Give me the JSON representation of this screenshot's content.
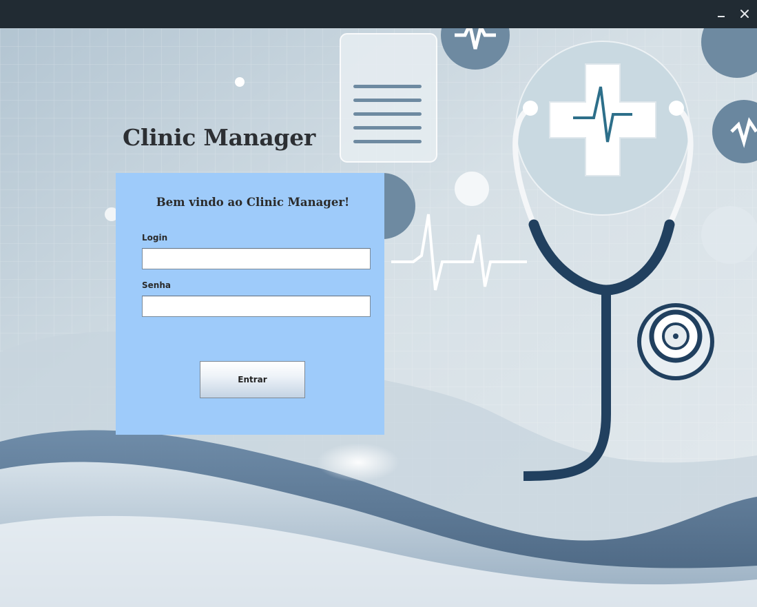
{
  "window": {
    "minimize_icon": "minimize-icon",
    "close_icon": "close-icon"
  },
  "app": {
    "title": "Clinic Manager"
  },
  "login_panel": {
    "welcome": "Bem vindo ao Clinic Manager!",
    "login_label": "Login",
    "login_value": "",
    "senha_label": "Senha",
    "senha_value": "",
    "submit_label": "Entrar"
  },
  "colors": {
    "titlebar": "#212b33",
    "panel": "#9ecbfa",
    "title_text": "#2c2f33",
    "background": "#dfe7ec",
    "stethoscope": "#21405f"
  }
}
